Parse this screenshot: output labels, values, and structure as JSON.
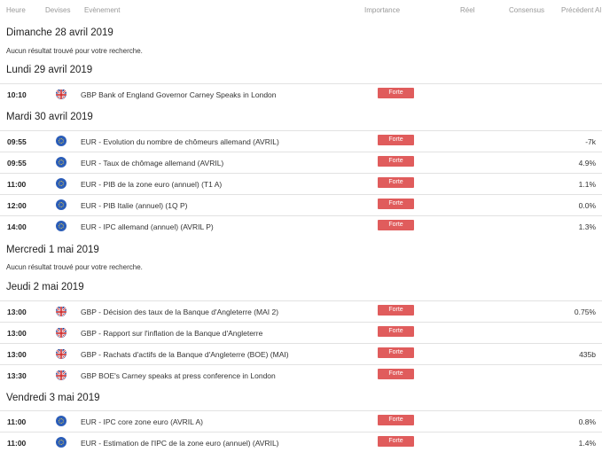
{
  "header": {
    "time": "Heure",
    "currency": "Devises",
    "event": "Evènement",
    "importance": "Importance",
    "actual": "Réel",
    "consensus": "Consensus",
    "previous": "Précédent",
    "alert": "Al"
  },
  "no_result_text": "Aucun résultat trouvé pour votre recherche.",
  "days": [
    {
      "label": "Dimanche 28 avril 2019"
    },
    {
      "label": "Lundi 29 avril 2019"
    },
    {
      "label": "Mardi 30 avril 2019"
    },
    {
      "label": "Mercredi 1 mai 2019"
    },
    {
      "label": "Jeudi 2 mai 2019"
    },
    {
      "label": "Vendredi 3 mai 2019"
    }
  ],
  "events": [
    {
      "time": "10:10",
      "flag": "gb-flag-icon",
      "event": "GBP Bank of England Governor Carney Speaks in London",
      "importance": "Forte",
      "previous": ""
    },
    {
      "time": "09:55",
      "flag": "eu-flag-icon",
      "event": "EUR - Evolution du nombre de chômeurs allemand (AVRIL)",
      "importance": "Forte",
      "previous": "-7k"
    },
    {
      "time": "09:55",
      "flag": "eu-flag-icon",
      "event": "EUR - Taux de chômage allemand (AVRIL)",
      "importance": "Forte",
      "previous": "4.9%"
    },
    {
      "time": "11:00",
      "flag": "eu-flag-icon",
      "event": "EUR - PIB de la zone euro (annuel) (T1 A)",
      "importance": "Forte",
      "previous": "1.1%"
    },
    {
      "time": "12:00",
      "flag": "eu-flag-icon",
      "event": "EUR - PIB Italie (annuel) (1Q P)",
      "importance": "Forte",
      "previous": "0.0%"
    },
    {
      "time": "14:00",
      "flag": "eu-flag-icon",
      "event": "EUR - IPC allemand (annuel) (AVRIL P)",
      "importance": "Forte",
      "previous": "1.3%"
    },
    {
      "time": "13:00",
      "flag": "gb-flag-icon",
      "event": "GBP - Décision des taux de la Banque d'Angleterre (MAI 2)",
      "importance": "Forte",
      "previous": "0.75%"
    },
    {
      "time": "13:00",
      "flag": "gb-flag-icon",
      "event": "GBP - Rapport sur l'inflation de la Banque d'Angleterre",
      "importance": "Forte",
      "previous": ""
    },
    {
      "time": "13:00",
      "flag": "gb-flag-icon",
      "event": "GBP - Rachats d'actifs de la Banque d'Angleterre (BOE) (MAI)",
      "importance": "Forte",
      "previous": "435b"
    },
    {
      "time": "13:30",
      "flag": "gb-flag-icon",
      "event": "GBP BOE's Carney speaks at press conference in London",
      "importance": "Forte",
      "previous": ""
    },
    {
      "time": "11:00",
      "flag": "eu-flag-icon",
      "event": "EUR - IPC core zone euro (AVRIL A)",
      "importance": "Forte",
      "previous": "0.8%"
    },
    {
      "time": "11:00",
      "flag": "eu-flag-icon",
      "event": "EUR - Estimation de l'IPC de la zone euro (annuel) (AVRIL)",
      "importance": "Forte",
      "previous": "1.4%"
    }
  ],
  "colors": {
    "importance_badge": "#e05c5c",
    "eu_flag": "#2b5db8",
    "row_border": "#e2e2e2"
  }
}
